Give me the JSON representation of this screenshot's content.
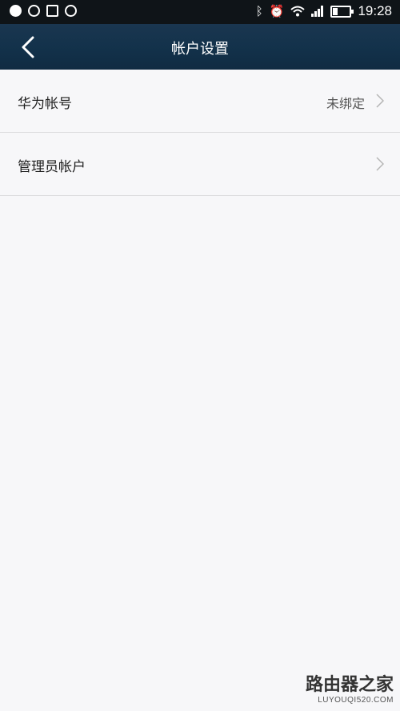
{
  "status_bar": {
    "left_icons": [
      "qq-icon",
      "sync-icon",
      "image-icon",
      "more-icon"
    ],
    "right_icons": [
      "bluetooth-icon",
      "alarm-icon",
      "wifi-icon",
      "signal-icon",
      "battery-icon"
    ],
    "time": "19:28"
  },
  "header": {
    "title": "帐户设置",
    "back_icon": "chevron-left-icon"
  },
  "list": {
    "items": [
      {
        "label": "华为帐号",
        "value": "未绑定"
      },
      {
        "label": "管理员帐户",
        "value": ""
      }
    ]
  },
  "watermark": {
    "title": "路由器之家",
    "url": "LUYOUQI520.COM"
  },
  "colors": {
    "header_bg": "#13324b",
    "status_bar_bg": "#0f1418",
    "page_bg": "#f7f7f9",
    "divider": "#dcdcde"
  }
}
